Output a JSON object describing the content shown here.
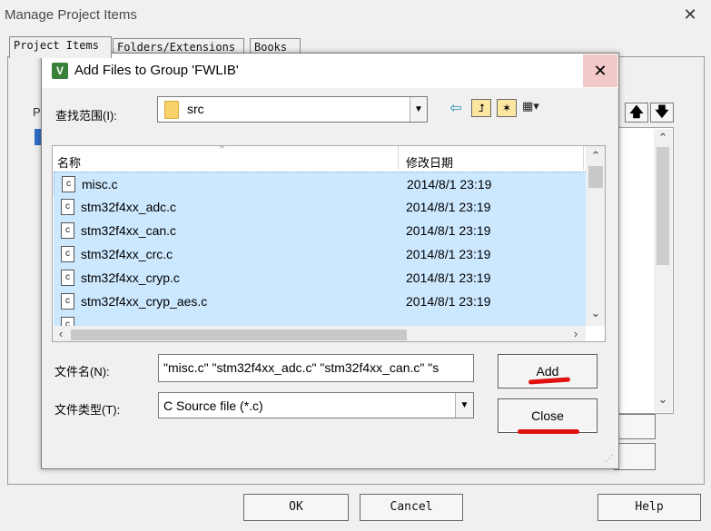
{
  "background_window": {
    "title": "Manage Project Items",
    "close_glyph": "✕",
    "tabs": [
      "Project Items",
      "Folders/Extensions",
      "Books"
    ],
    "left_label": "P",
    "buttons": {
      "ok": "OK",
      "cancel": "Cancel",
      "help": "Help"
    }
  },
  "dialog": {
    "title": "Add Files to Group 'FWLIB'",
    "close_glyph": "✕",
    "look_in": {
      "label": "查找范围(I):",
      "value": "src"
    },
    "columns": {
      "name": "名称",
      "date": "修改日期"
    },
    "files": [
      {
        "name": "misc.c",
        "date": "2014/8/1 23:19"
      },
      {
        "name": "stm32f4xx_adc.c",
        "date": "2014/8/1 23:19"
      },
      {
        "name": "stm32f4xx_can.c",
        "date": "2014/8/1 23:19"
      },
      {
        "name": "stm32f4xx_crc.c",
        "date": "2014/8/1 23:19"
      },
      {
        "name": "stm32f4xx_cryp.c",
        "date": "2014/8/1 23:19"
      },
      {
        "name": "stm32f4xx_cryp_aes.c",
        "date": "2014/8/1 23:19"
      }
    ],
    "file_name": {
      "label": "文件名(N):",
      "value": "\"misc.c\" \"stm32f4xx_adc.c\" \"stm32f4xx_can.c\" \"s"
    },
    "file_type": {
      "label": "文件类型(T):",
      "value": "C Source file (*.c)"
    },
    "buttons": {
      "add": "Add",
      "close": "Close"
    }
  },
  "icons": {
    "back": "back-arrow-icon",
    "up": "up-folder-icon",
    "new_folder": "new-folder-icon",
    "view_menu": "view-menu-icon",
    "file": "c-file-icon",
    "folder": "folder-icon"
  },
  "colors": {
    "selection": "#cce8ff",
    "close_hover": "#f2c8c8",
    "annotation_red": "#e01010"
  }
}
